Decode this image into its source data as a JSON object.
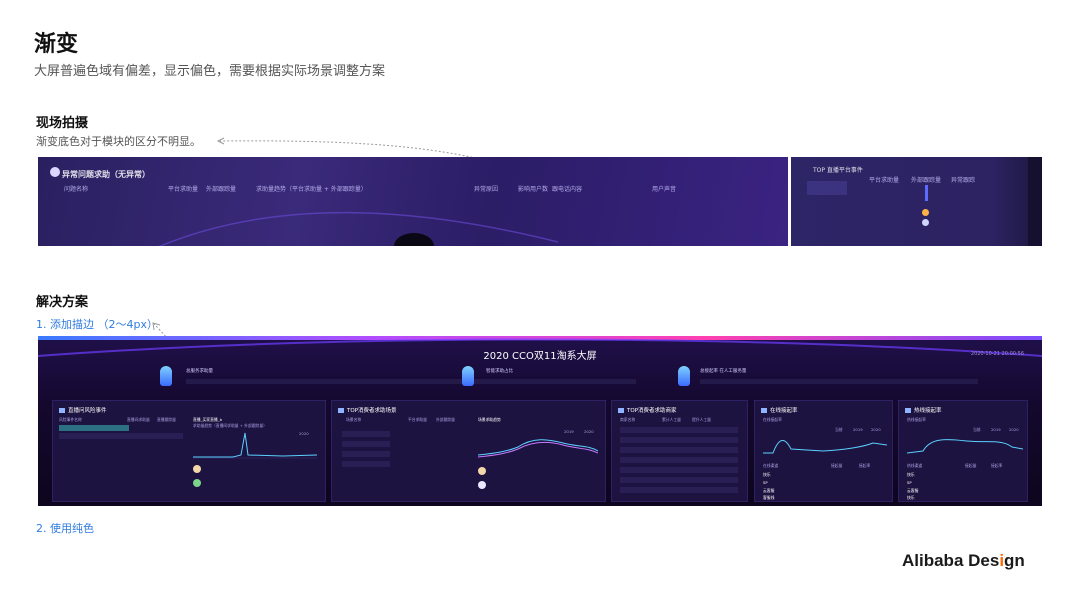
{
  "title": "渐变",
  "subtitle": "大屏普遍色域有偏差，显示偏色，需要根据实际场景调整方案",
  "section1": {
    "heading": "现场拍摄",
    "note": "渐变底色对于模块的区分不明显。",
    "photoA_texts": [
      "异常问题求助（无异常）",
      "问题名称",
      "平台求助量",
      "外部跟踪量",
      "求助量趋势（平台求助量 + 外部跟踪量）",
      "异常原因",
      "影响用户数",
      "跟电话内容",
      "用户声音"
    ],
    "photoB_texts": [
      "TOP 直播平台事件",
      "平台求助量",
      "外部跟踪量",
      "异常跟踪"
    ]
  },
  "section2": {
    "heading": "解决方案",
    "option1": "1. 添加描边 （2～4px）",
    "option2": "2. 使用纯色"
  },
  "dashboard": {
    "title": "2020 CCO双11淘系大屏",
    "time": "2020-10-21 20:00:56",
    "kpis": [
      "总服务求助量",
      "智能求助占比",
      "总接起率  在人工服务量"
    ],
    "panels": [
      {
        "title": "直播问风险事件",
        "labels": [
          "风险事件名称",
          "直播间求助量",
          "直播跟踪量",
          "直播_买家直播_b",
          "求助量趋势（直播间求助量 + 外部跟踪量）",
          "2020"
        ]
      },
      {
        "title": "TOP消费者求助场景",
        "labels": [
          "场景名称",
          "平台求助量",
          "外部跟踪量",
          "场景求助趋势",
          "2019",
          "2020"
        ]
      },
      {
        "title": "TOP消费者求助商家",
        "labels": [
          "商家名称",
          "累计人工量",
          "提升人工量"
        ]
      },
      {
        "title": "在线接起率",
        "labels": [
          "在线接起率",
          "当前",
          "2019",
          "2020",
          "在线渠道",
          "接起量",
          "接起率",
          "快乐",
          "SP",
          "云客服",
          "客服线"
        ]
      },
      {
        "title": "热线接起率",
        "labels": [
          "热线接起率",
          "当前",
          "2019",
          "2020",
          "热线渠道",
          "接起量",
          "接起率",
          "快乐",
          "SP",
          "云客服",
          "快乐"
        ]
      }
    ]
  },
  "brand": {
    "before": "Alibaba Des",
    "accent": "i",
    "after": "gn"
  },
  "colors": {
    "accent_blue": "#2f7be0",
    "brand_orange": "#ff6a00",
    "dash_bg": "#14082e"
  }
}
